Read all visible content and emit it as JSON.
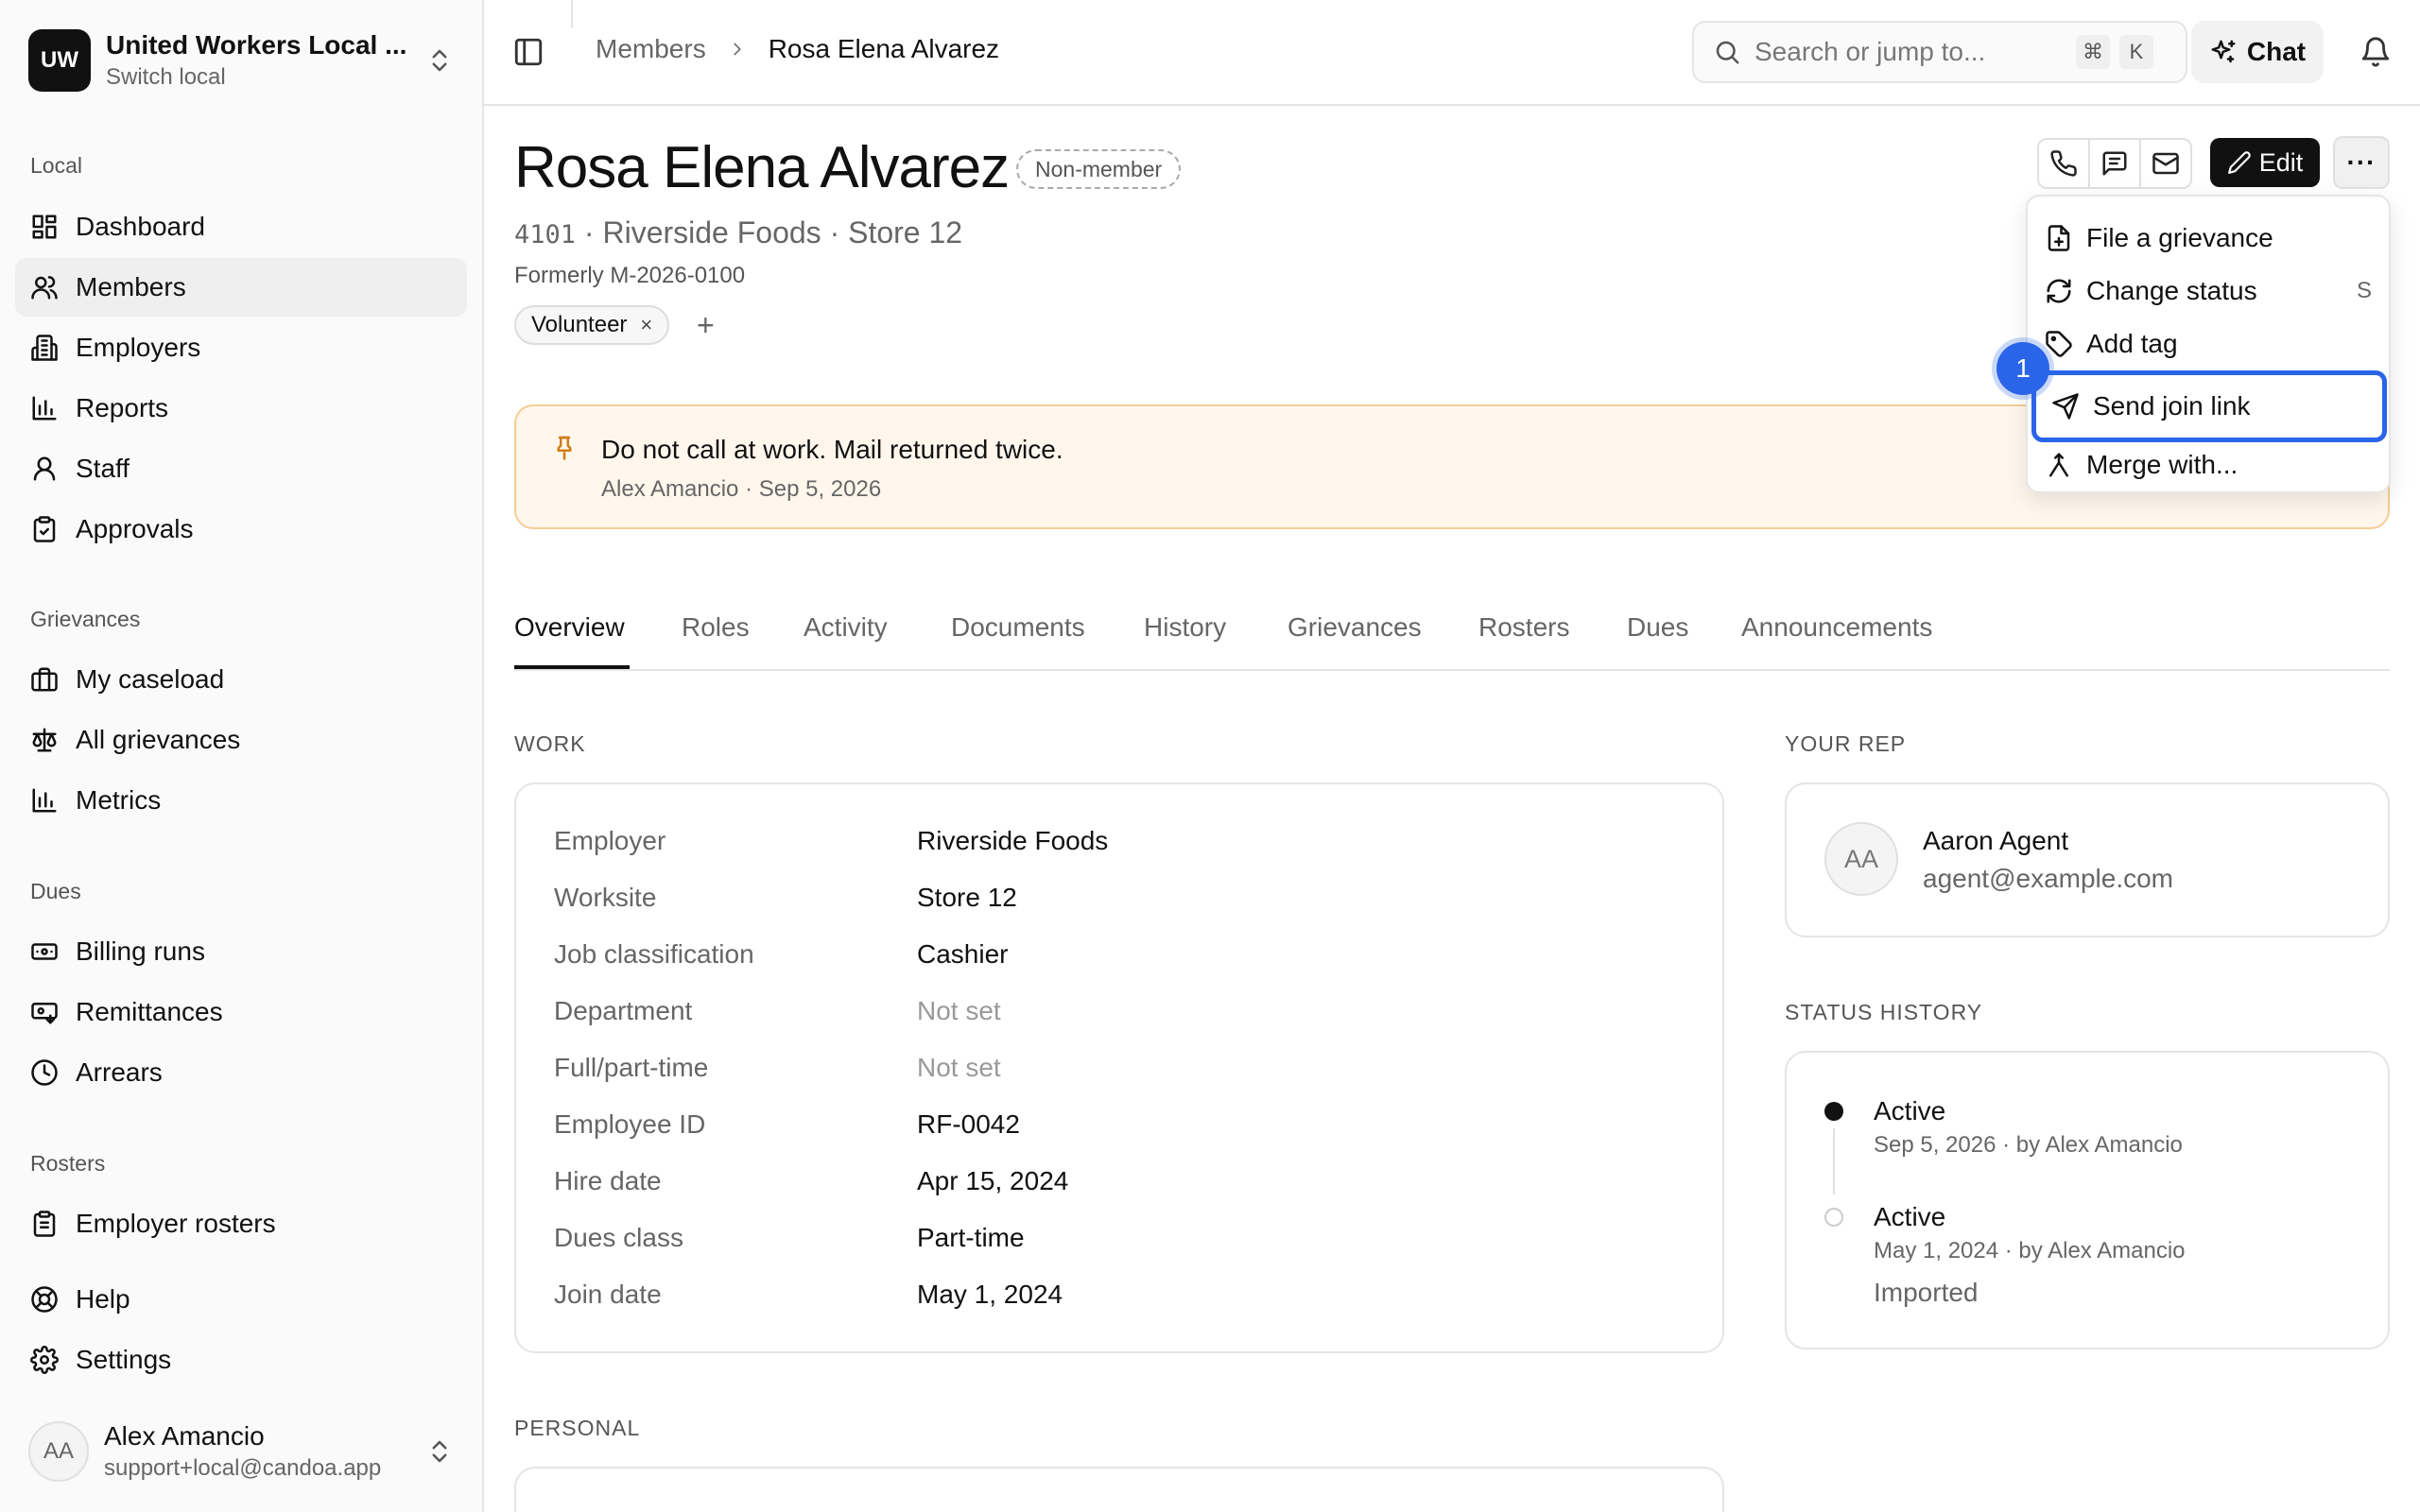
{
  "org": {
    "initials": "UW",
    "name": "United Workers Local ...",
    "sub": "Switch local"
  },
  "sidebar": {
    "sections": [
      {
        "title": "Local",
        "items": [
          {
            "label": "Dashboard",
            "icon": "dashboard-icon"
          },
          {
            "label": "Members",
            "icon": "users-icon",
            "active": true
          },
          {
            "label": "Employers",
            "icon": "building-icon"
          },
          {
            "label": "Reports",
            "icon": "bar-chart-icon"
          },
          {
            "label": "Staff",
            "icon": "user-icon"
          },
          {
            "label": "Approvals",
            "icon": "clipboard-check-icon"
          }
        ]
      },
      {
        "title": "Grievances",
        "items": [
          {
            "label": "My caseload",
            "icon": "briefcase-icon"
          },
          {
            "label": "All grievances",
            "icon": "scale-icon"
          },
          {
            "label": "Metrics",
            "icon": "bar-chart-icon"
          }
        ]
      },
      {
        "title": "Dues",
        "items": [
          {
            "label": "Billing runs",
            "icon": "banknote-icon"
          },
          {
            "label": "Remittances",
            "icon": "wallet-icon"
          },
          {
            "label": "Arrears",
            "icon": "clock-icon"
          }
        ]
      },
      {
        "title": "Rosters",
        "items": [
          {
            "label": "Employer rosters",
            "icon": "clipboard-list-icon"
          }
        ]
      }
    ],
    "footer_items": [
      {
        "label": "Help",
        "icon": "lifebuoy-icon"
      },
      {
        "label": "Settings",
        "icon": "gear-icon"
      }
    ]
  },
  "user": {
    "initials": "AA",
    "name": "Alex Amancio",
    "email": "support+local@candoa.app"
  },
  "topbar": {
    "breadcrumb_parent": "Members",
    "breadcrumb_current": "Rosa Elena Alvarez",
    "search_placeholder": "Search or jump to...",
    "kbd_cmd": "⌘",
    "kbd_key": "K",
    "chat_label": "Chat"
  },
  "member": {
    "name": "Rosa Elena Alvarez",
    "badge": "Non-member",
    "number": "4101",
    "employer_line": "· Riverside Foods · Store 12",
    "formerly": "Formerly M-2026-0100",
    "tag": "Volunteer",
    "tag_remove": "×",
    "add_tag": "+"
  },
  "actions": {
    "edit_label": "Edit",
    "more_label": "···"
  },
  "notice": {
    "text": "Do not call at work. Mail returned twice.",
    "meta": "Alex Amancio · Sep 5, 2026",
    "accent": "#d07d16"
  },
  "tabs": [
    "Overview",
    "Roles",
    "Activity",
    "Documents",
    "History",
    "Grievances",
    "Rosters",
    "Dues",
    "Announcements"
  ],
  "active_tab": "Overview",
  "work": {
    "title": "WORK",
    "rows": [
      {
        "label": "Employer",
        "value": "Riverside Foods",
        "muted": false
      },
      {
        "label": "Worksite",
        "value": "Store 12",
        "muted": false
      },
      {
        "label": "Job classification",
        "value": "Cashier",
        "muted": false
      },
      {
        "label": "Department",
        "value": "Not set",
        "muted": true
      },
      {
        "label": "Full/part-time",
        "value": "Not set",
        "muted": true
      },
      {
        "label": "Employee ID",
        "value": "RF-0042",
        "muted": false
      },
      {
        "label": "Hire date",
        "value": "Apr 15, 2024",
        "muted": false
      },
      {
        "label": "Dues class",
        "value": "Part-time",
        "muted": false
      },
      {
        "label": "Join date",
        "value": "May 1, 2024",
        "muted": false
      }
    ]
  },
  "rep": {
    "title": "YOUR REP",
    "initials": "AA",
    "name": "Aaron Agent",
    "email": "agent@example.com"
  },
  "status_history": {
    "title": "STATUS HISTORY",
    "entries": [
      {
        "status": "Active",
        "meta": "Sep 5, 2026 · by Alex Amancio",
        "note": ""
      },
      {
        "status": "Active",
        "meta": "May 1, 2024 · by Alex Amancio",
        "note": "Imported"
      }
    ]
  },
  "personal": {
    "title": "PERSONAL"
  },
  "menu": {
    "items": [
      {
        "label": "File a grievance",
        "icon": "file-plus-icon",
        "shortcut": ""
      },
      {
        "label": "Change status",
        "icon": "refresh-icon",
        "shortcut": "S"
      },
      {
        "label": "Add tag",
        "icon": "tag-icon",
        "shortcut": ""
      },
      {
        "label": "Send join link",
        "icon": "send-icon",
        "shortcut": ""
      },
      {
        "label": "Merge with...",
        "icon": "merge-icon",
        "shortcut": ""
      }
    ],
    "highlight_color": "#2a64e8",
    "step_number": "1"
  }
}
